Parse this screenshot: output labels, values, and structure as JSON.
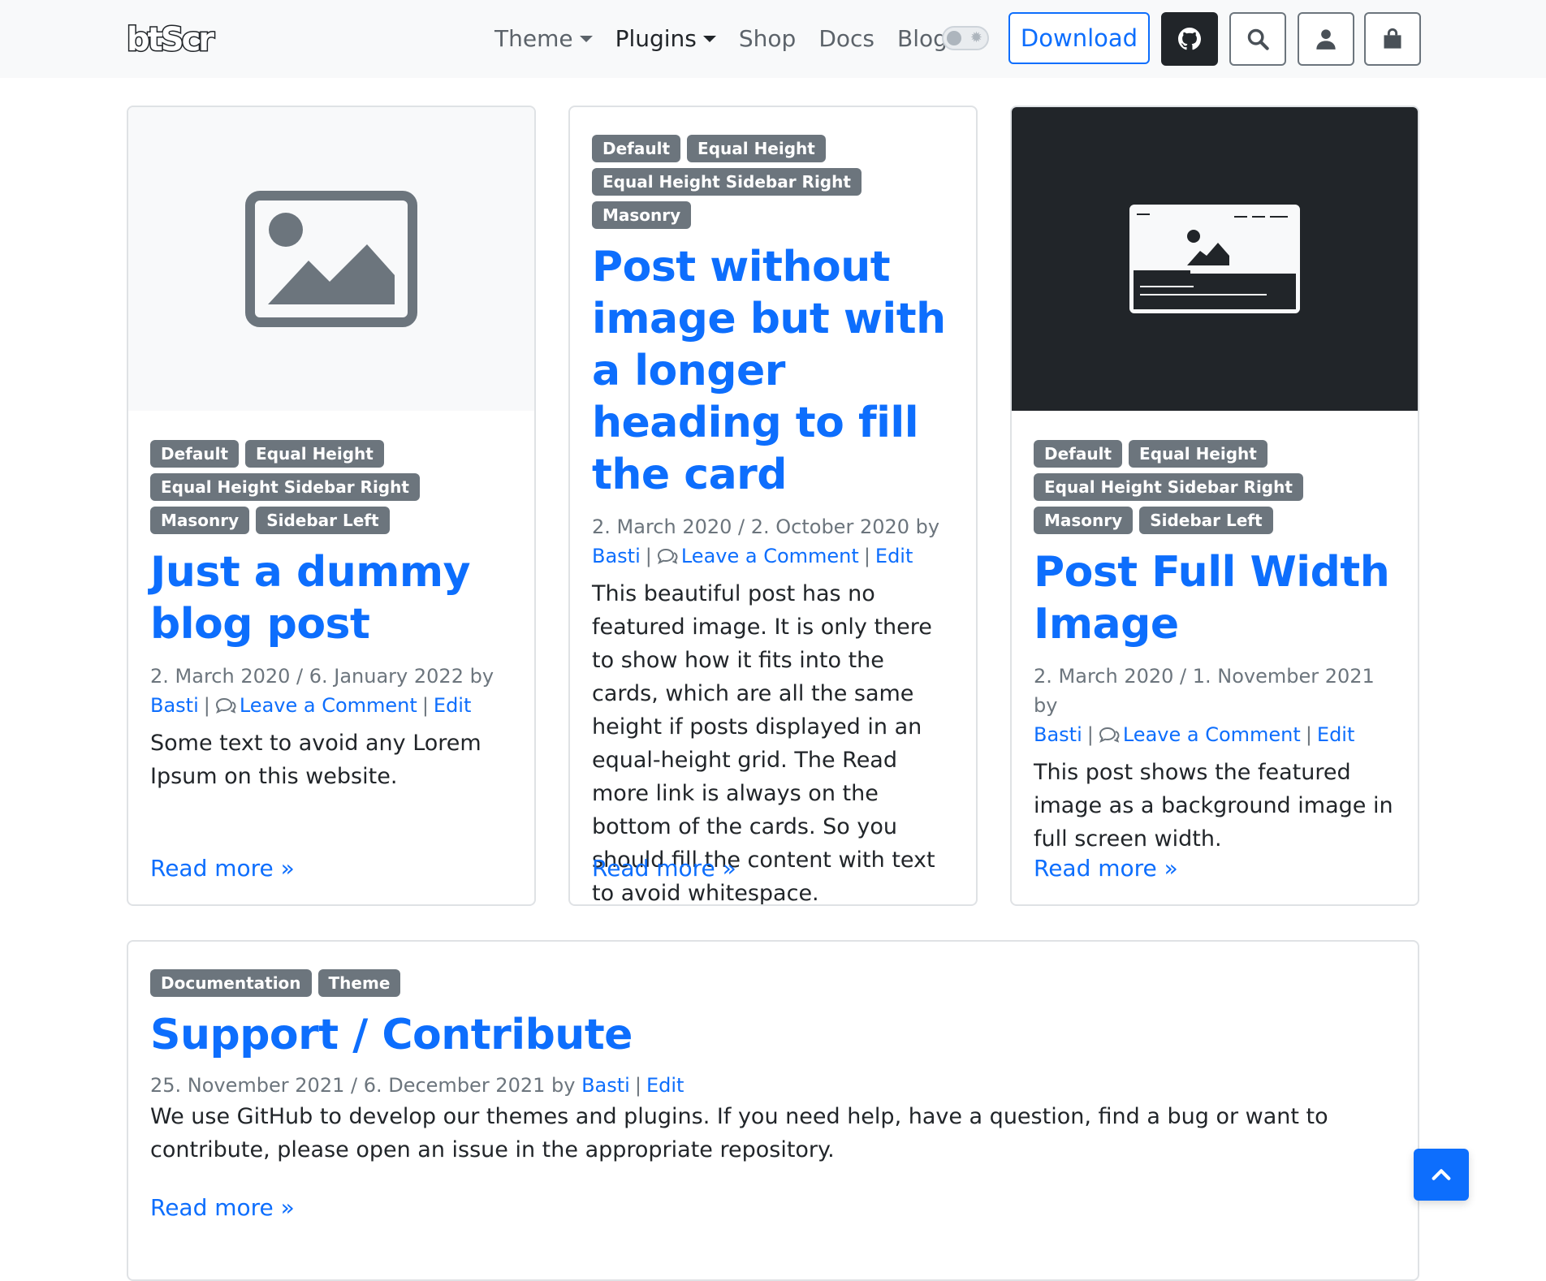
{
  "navbar": {
    "logo": "btScr",
    "links": [
      {
        "label": "Theme",
        "dropdown": true
      },
      {
        "label": "Plugins",
        "dropdown": true
      },
      {
        "label": "Shop",
        "dropdown": false
      },
      {
        "label": "Docs",
        "dropdown": false
      },
      {
        "label": "Blog",
        "dropdown": false
      }
    ],
    "download_label": "Download",
    "icons": [
      "github-icon",
      "search-icon",
      "user-icon",
      "bag-icon"
    ]
  },
  "posts": [
    {
      "image": "placeholder-image-icon",
      "badges": [
        "Default",
        "Equal Height",
        "Equal Height Sidebar Right",
        "Masonry",
        "Sidebar Left"
      ],
      "title": "Just a dummy blog post",
      "dates": "2. March 2020 / 6. January 2022 by",
      "author": "Basti",
      "comment": "Leave a Comment",
      "edit": "Edit",
      "excerpt": "Some text to avoid any Lorem Ipsum on this website.",
      "read_more": "Read more »"
    },
    {
      "image": "",
      "badges": [
        "Default",
        "Equal Height",
        "Equal Height Sidebar Right",
        "Masonry"
      ],
      "title": "Post without image but with a longer heading to fill the card",
      "dates": "2. March 2020 / 2. October 2020 by",
      "author": "Basti",
      "comment": "Leave a Comment",
      "edit": "Edit",
      "excerpt": "This beautiful post has no featured image. It is only there to show how it fits into the cards, which are all the same height if posts displayed in an equal-height grid. The Read more link is always on the bottom of the cards. So you should fill the content with text to avoid whitespace.",
      "read_more": "Read more »"
    },
    {
      "image": "browser-window-icon",
      "badges": [
        "Default",
        "Equal Height",
        "Equal Height Sidebar Right",
        "Masonry",
        "Sidebar Left"
      ],
      "title": "Post Full Width Image",
      "dates": "2. March 2020 / 1. November 2021 by",
      "author": "Basti",
      "comment": "Leave a Comment",
      "edit": "Edit",
      "excerpt": "This post shows the featured image as a background image in full screen width.",
      "read_more": "Read more »"
    },
    {
      "image": "",
      "badges": [
        "Documentation",
        "Theme"
      ],
      "title": "Support / Contribute",
      "dates": "25. November 2021 / 6. December 2021 by",
      "author": "Basti",
      "edit": "Edit",
      "excerpt": "We use GitHub to develop our themes and plugins. If you need help, have a question, find a bug or want to contribute, please open an issue in the appropriate repository.",
      "read_more": "Read more »"
    }
  ],
  "scroll_top_icon": "chevron-up-icon",
  "colors": {
    "primary": "#0d6efd",
    "badge": "#6c757d",
    "dark": "#212529",
    "navbar_bg": "#f8f9fa"
  }
}
